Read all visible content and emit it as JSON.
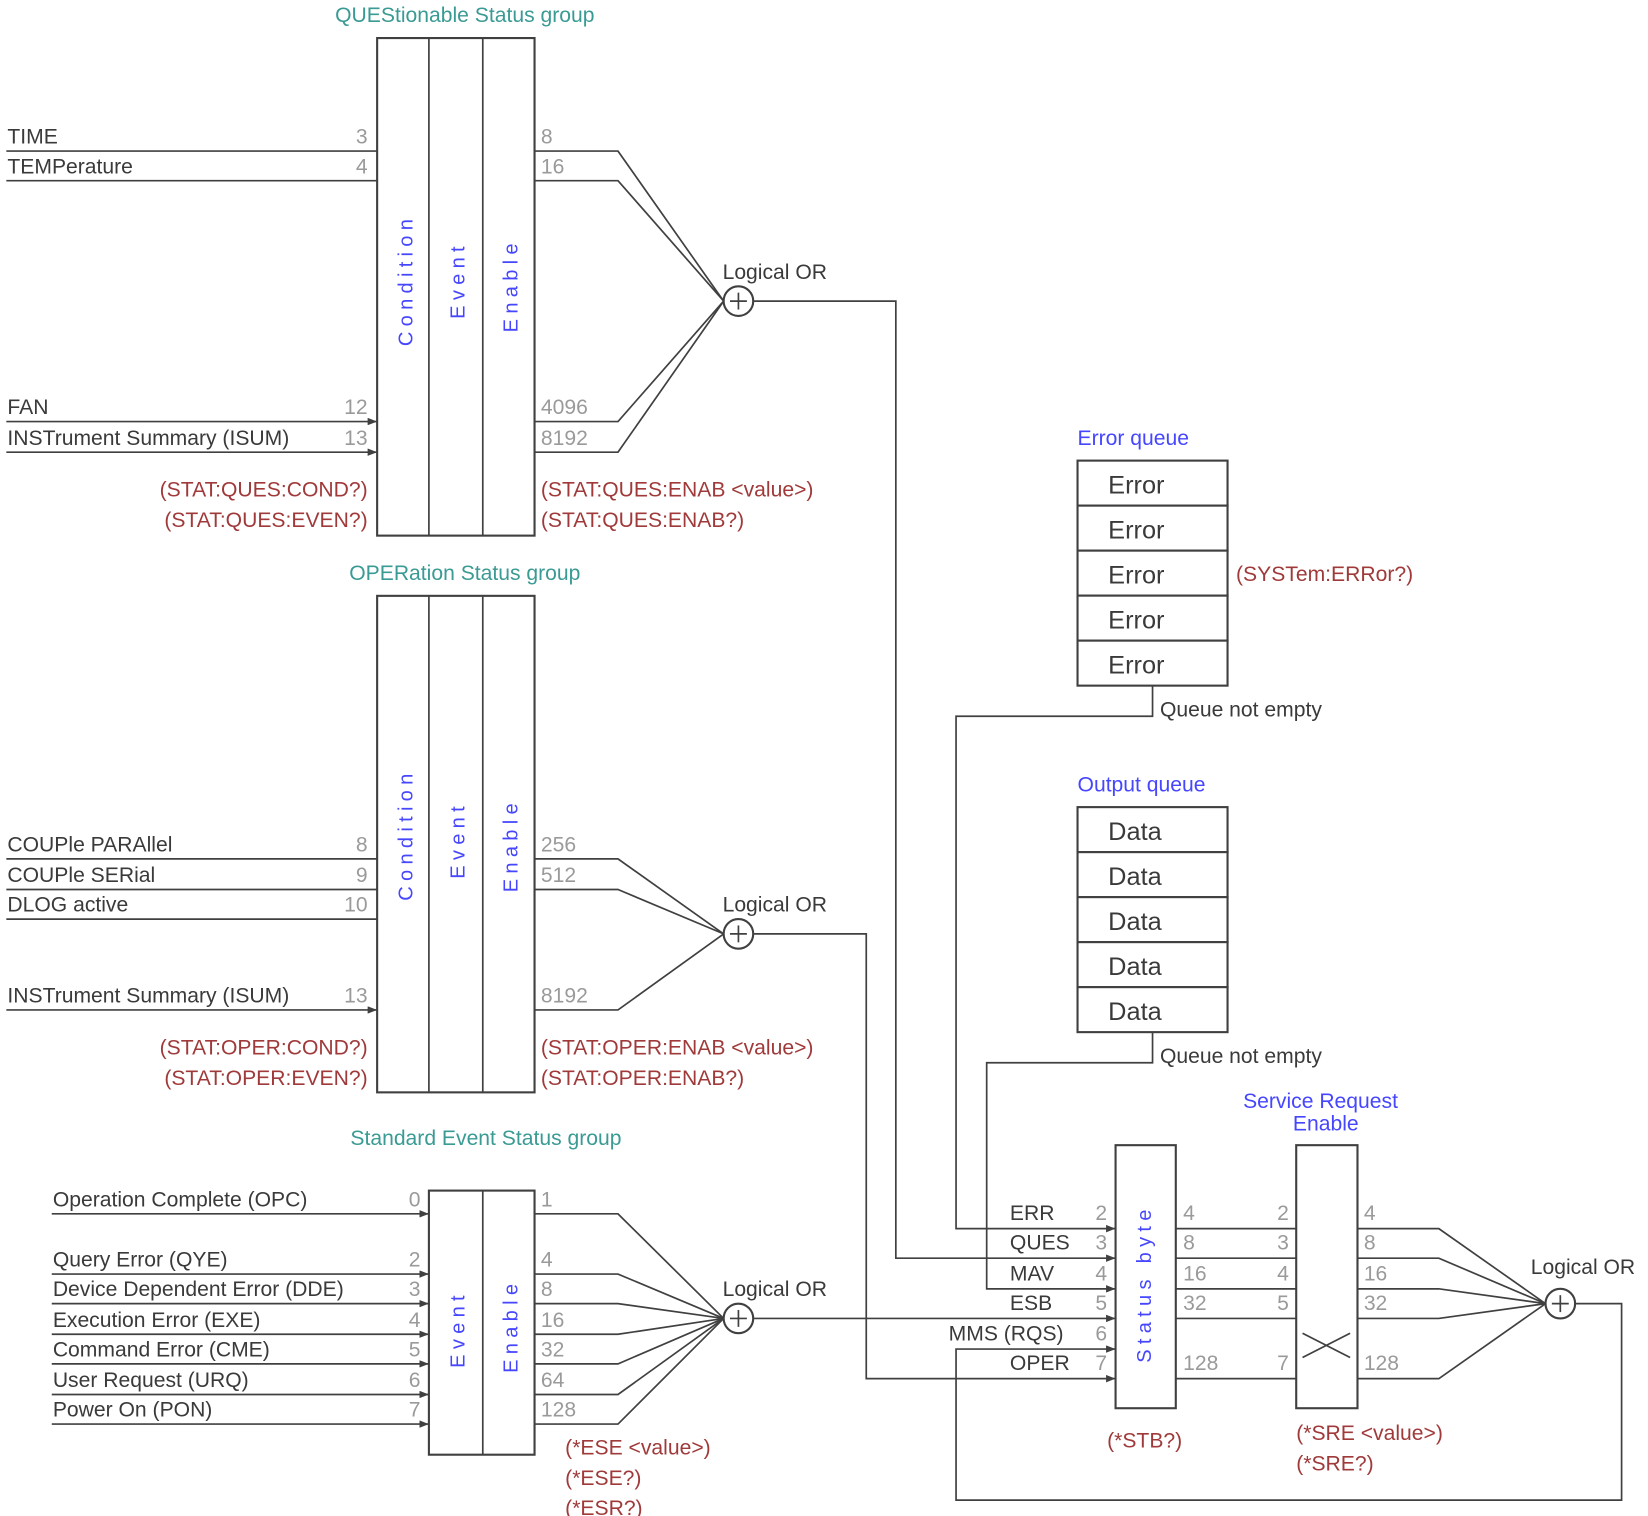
{
  "colors": {
    "line": "#404040",
    "bit_number": "#9a9a9a",
    "group_title": "#3a9a94",
    "register_label": "#4646ff",
    "query_command": "#a03a3a"
  },
  "questionable": {
    "title": "QUEStionable Status group",
    "registers": [
      "Condition",
      "Event",
      "Enable"
    ],
    "inputs": [
      {
        "label": "TIME",
        "bit": "3"
      },
      {
        "label": "TEMPerature",
        "bit": "4"
      },
      {
        "label": "FAN",
        "bit": "12"
      },
      {
        "label": "INSTrument Summary (ISUM)",
        "bit": "13"
      }
    ],
    "outputs": [
      "8",
      "16",
      "4096",
      "8192"
    ],
    "or_label": "Logical OR",
    "queries_left": [
      "(STAT:QUES:COND?)",
      "(STAT:QUES:EVEN?)"
    ],
    "queries_right": [
      "(STAT:QUES:ENAB <value>)",
      "(STAT:QUES:ENAB?)"
    ]
  },
  "operation": {
    "title": "OPERation Status group",
    "registers": [
      "Condition",
      "Event",
      "Enable"
    ],
    "inputs": [
      {
        "label": "COUPle PARAllel",
        "bit": "8"
      },
      {
        "label": "COUPle SERial",
        "bit": "9"
      },
      {
        "label": "DLOG active",
        "bit": "10"
      },
      {
        "label": "INSTrument Summary (ISUM)",
        "bit": "13"
      }
    ],
    "outputs": [
      "256",
      "512",
      "8192"
    ],
    "or_label": "Logical OR",
    "queries_left": [
      "(STAT:OPER:COND?)",
      "(STAT:OPER:EVEN?)"
    ],
    "queries_right": [
      "(STAT:OPER:ENAB <value>)",
      "(STAT:OPER:ENAB?)"
    ]
  },
  "standard_event": {
    "title": "Standard Event Status group",
    "registers": [
      "Event",
      "Enable"
    ],
    "inputs": [
      {
        "label": "Operation Complete (OPC)",
        "bit": "0"
      },
      {
        "label": "Query Error (QYE)",
        "bit": "2"
      },
      {
        "label": "Device Dependent Error (DDE)",
        "bit": "3"
      },
      {
        "label": "Execution Error (EXE)",
        "bit": "4"
      },
      {
        "label": "Command Error (CME)",
        "bit": "5"
      },
      {
        "label": "User Request (URQ)",
        "bit": "6"
      },
      {
        "label": "Power On (PON)",
        "bit": "7"
      }
    ],
    "outputs": [
      "1",
      "4",
      "8",
      "16",
      "32",
      "64",
      "128"
    ],
    "or_label": "Logical OR",
    "queries": [
      "(*ESE <value>)",
      "(*ESE?)",
      "(*ESR?)"
    ]
  },
  "error_queue": {
    "title": "Error queue",
    "entries": [
      "Error",
      "Error",
      "Error",
      "Error",
      "Error"
    ],
    "query": "(SYSTem:ERRor?)",
    "status": "Queue not empty"
  },
  "output_queue": {
    "title": "Output queue",
    "entries": [
      "Data",
      "Data",
      "Data",
      "Data",
      "Data"
    ],
    "status": "Queue not empty"
  },
  "status_byte": {
    "label": "Status byte",
    "inputs": [
      {
        "label": "ERR",
        "bit": "2"
      },
      {
        "label": "QUES",
        "bit": "3"
      },
      {
        "label": "MAV",
        "bit": "4"
      },
      {
        "label": "ESB",
        "bit": "5"
      },
      {
        "label": "MMS (RQS)",
        "bit": "6"
      },
      {
        "label": "OPER",
        "bit": "7"
      }
    ],
    "outputs": [
      "4",
      "8",
      "16",
      "32",
      "128"
    ],
    "query": "(*STB?)"
  },
  "service_request_enable": {
    "title": [
      "Service Request",
      "Enable"
    ],
    "bits": [
      "2",
      "3",
      "4",
      "5",
      "7"
    ],
    "outputs": [
      "4",
      "8",
      "16",
      "32",
      "128"
    ],
    "or_label": "Logical OR",
    "queries": [
      "(*SRE <value>)",
      "(*SRE?)"
    ]
  }
}
